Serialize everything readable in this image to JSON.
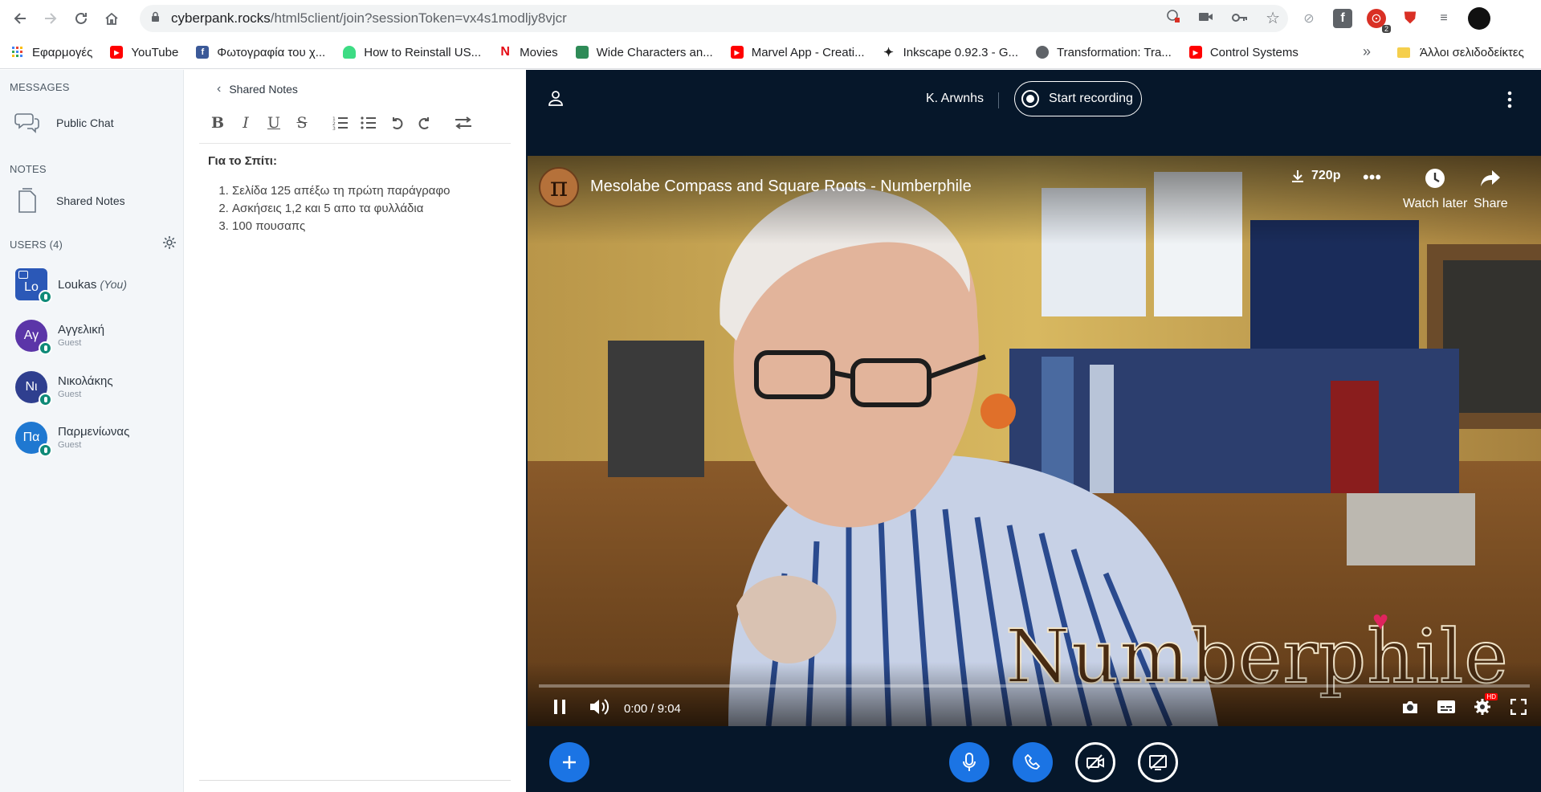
{
  "browser": {
    "url_host": "cyberpank.rocks",
    "url_path": "/html5client/join?sessionToken=vx4s1modljy8vjcr",
    "ext_badge": "2",
    "bookmarks": [
      {
        "label": "Εφαρμογές",
        "icon": "apps-grid-icon",
        "color": "#4285f4"
      },
      {
        "label": "YouTube",
        "icon": "youtube-icon",
        "color": "#ff0000"
      },
      {
        "label": "Φωτογραφία του χ...",
        "icon": "facebook-icon",
        "color": "#3b5998"
      },
      {
        "label": "How to Reinstall US...",
        "icon": "android-icon",
        "color": "#3ddc84"
      },
      {
        "label": "Movies",
        "icon": "netflix-icon",
        "color": "#e50914"
      },
      {
        "label": "Wide Characters an...",
        "icon": "bag-icon",
        "color": "#2e8b57"
      },
      {
        "label": "Marvel App - Creati...",
        "icon": "youtube-icon",
        "color": "#ff0000"
      },
      {
        "label": "Inkscape 0.92.3 - G...",
        "icon": "inkscape-icon",
        "color": "#222222"
      },
      {
        "label": "Transformation: Tra...",
        "icon": "globe-icon",
        "color": "#5f6368"
      },
      {
        "label": "Control Systems",
        "icon": "youtube-icon",
        "color": "#ff0000"
      }
    ],
    "bookmarks_more": "»",
    "other_bookmarks": "Άλλοι σελιδοδείκτες"
  },
  "sidebar": {
    "messages_title": "MESSAGES",
    "public_chat": "Public Chat",
    "notes_title": "NOTES",
    "shared_notes": "Shared Notes",
    "users_title": "USERS (4)",
    "users": [
      {
        "initials": "Lo",
        "name": "Loukas",
        "you": "(You)",
        "role": "",
        "color": "#2b58b7",
        "square": true
      },
      {
        "initials": "Αγ",
        "name": "Αγγελική",
        "role": "Guest",
        "color": "#5b35a8"
      },
      {
        "initials": "Νι",
        "name": "Νικολάκης",
        "role": "Guest",
        "color": "#2f3f8f"
      },
      {
        "initials": "Πα",
        "name": "Παρμενίωνας",
        "role": "Guest",
        "color": "#1f78d1"
      }
    ]
  },
  "notes": {
    "back_label": "Shared Notes",
    "title": "Για το Σπίτι:",
    "items": [
      "Σελίδα 125 απέξω τη πρώτη παράγραφο",
      "Ασκήσεις 1,2 και 5 απο τα φυλλάδια",
      "100 πουσαπς"
    ]
  },
  "meeting": {
    "name": "K. Arwnhs",
    "record_label": "Start recording"
  },
  "video": {
    "title": "Mesolabe Compass and Square Roots - Numberphile",
    "quality": "720p",
    "watch_later": "Watch later",
    "share": "Share",
    "time": "0:00 / 9:04",
    "progress": 0,
    "watermark": "Numberphile",
    "hd_badge": "HD"
  }
}
